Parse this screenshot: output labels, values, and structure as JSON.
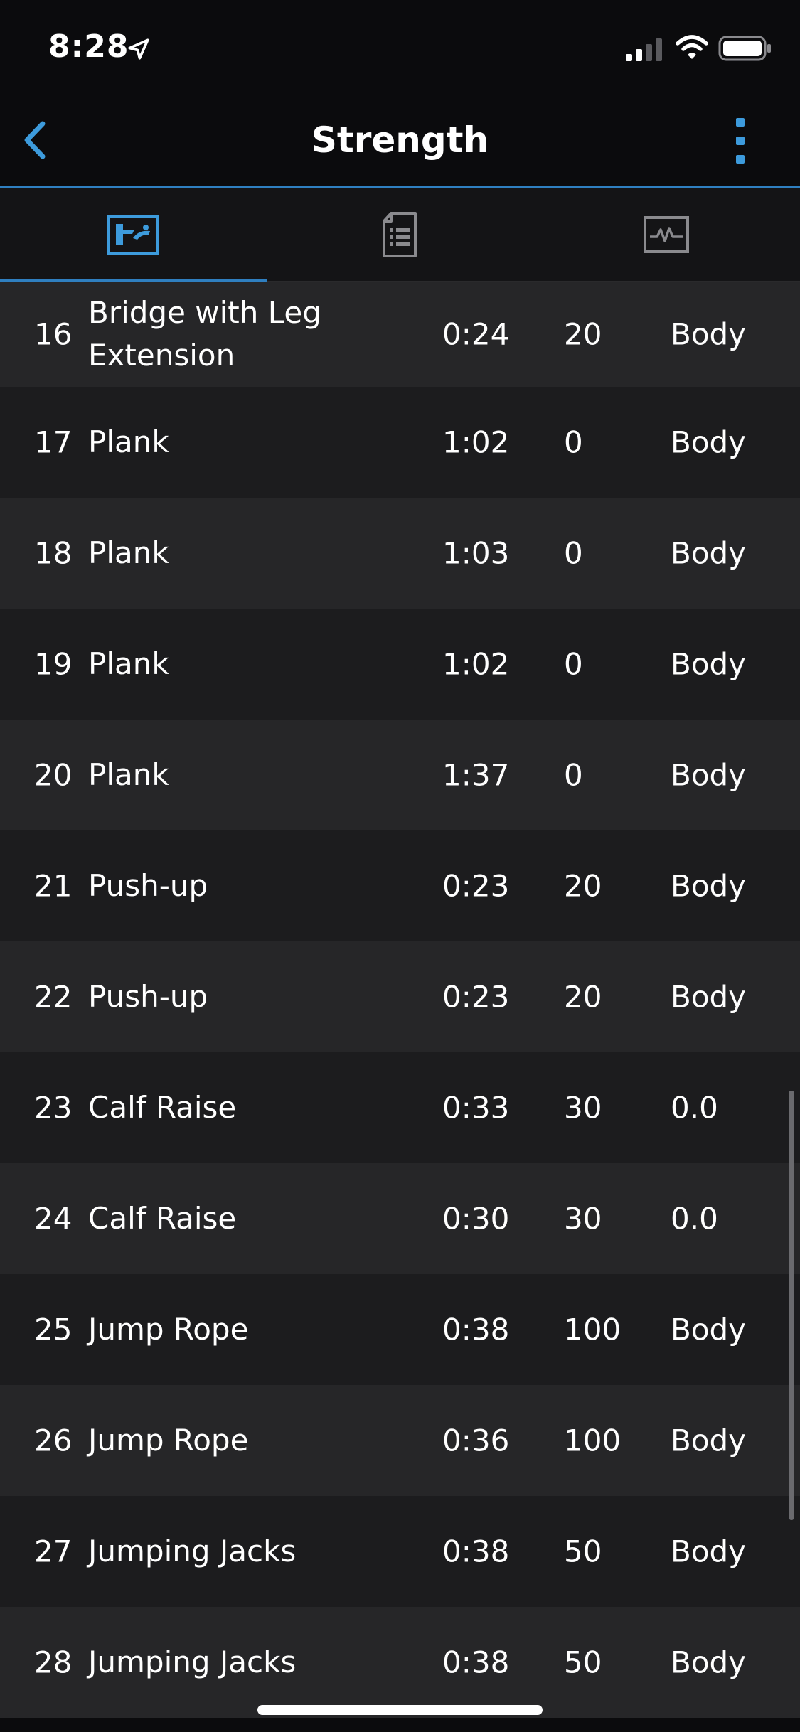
{
  "status_bar": {
    "time": "8:28"
  },
  "nav": {
    "title": "Strength"
  },
  "tabs": [
    {
      "name": "summary",
      "selected": true
    },
    {
      "name": "details",
      "selected": false
    },
    {
      "name": "charts",
      "selected": false
    }
  ],
  "colors": {
    "accent": "#3d9bdc",
    "background": "#0b0b0d",
    "row_light": "#262628",
    "row_dark": "#1c1c1e"
  },
  "sets": [
    {
      "num": "16",
      "name": "Bridge with Leg Extension",
      "time": "0:24",
      "reps": "20",
      "weight": "Body"
    },
    {
      "num": "17",
      "name": "Plank",
      "time": "1:02",
      "reps": "0",
      "weight": "Body"
    },
    {
      "num": "18",
      "name": "Plank",
      "time": "1:03",
      "reps": "0",
      "weight": "Body"
    },
    {
      "num": "19",
      "name": "Plank",
      "time": "1:02",
      "reps": "0",
      "weight": "Body"
    },
    {
      "num": "20",
      "name": "Plank",
      "time": "1:37",
      "reps": "0",
      "weight": "Body"
    },
    {
      "num": "21",
      "name": "Push-up",
      "time": "0:23",
      "reps": "20",
      "weight": "Body"
    },
    {
      "num": "22",
      "name": "Push-up",
      "time": "0:23",
      "reps": "20",
      "weight": "Body"
    },
    {
      "num": "23",
      "name": "Calf Raise",
      "time": "0:33",
      "reps": "30",
      "weight": "0.0"
    },
    {
      "num": "24",
      "name": "Calf Raise",
      "time": "0:30",
      "reps": "30",
      "weight": "0.0"
    },
    {
      "num": "25",
      "name": "Jump Rope",
      "time": "0:38",
      "reps": "100",
      "weight": "Body"
    },
    {
      "num": "26",
      "name": "Jump Rope",
      "time": "0:36",
      "reps": "100",
      "weight": "Body"
    },
    {
      "num": "27",
      "name": "Jumping Jacks",
      "time": "0:38",
      "reps": "50",
      "weight": "Body"
    },
    {
      "num": "28",
      "name": "Jumping Jacks",
      "time": "0:38",
      "reps": "50",
      "weight": "Body"
    }
  ]
}
